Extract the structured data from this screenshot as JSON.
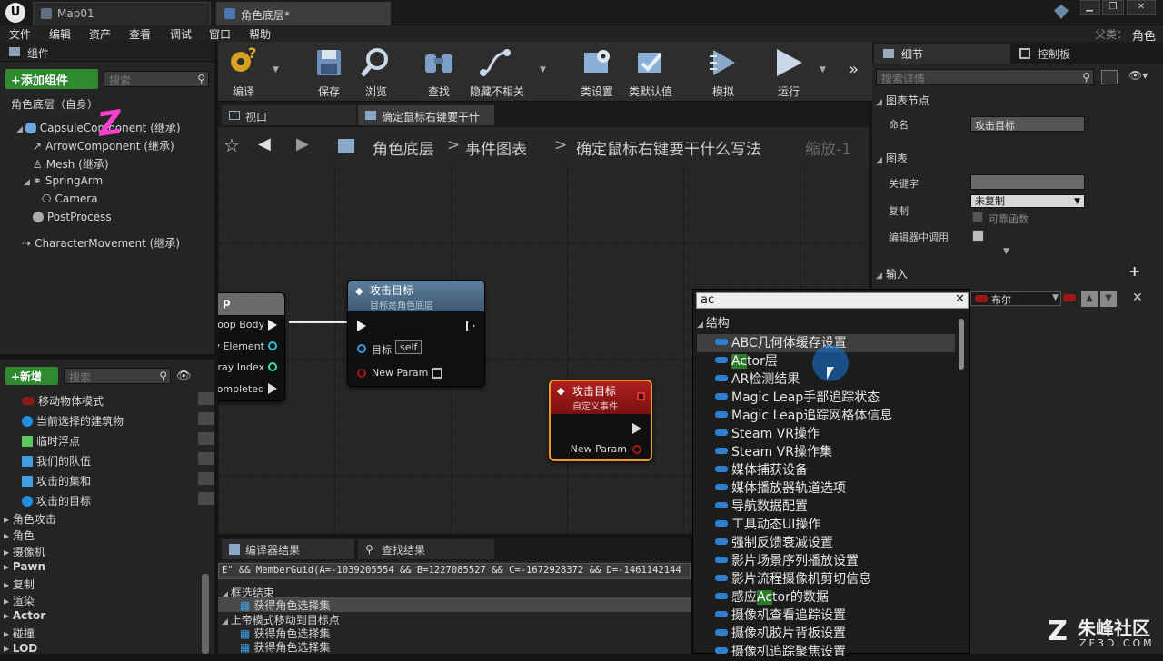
{
  "window": {
    "tabs": [
      {
        "label": "Map01"
      },
      {
        "label": "角色底层*"
      }
    ],
    "parent_label": "父类：",
    "parent_value": "角色"
  },
  "menu": [
    "文件",
    "编辑",
    "资产",
    "查看",
    "调试",
    "窗口",
    "帮助"
  ],
  "components": {
    "title": "组件",
    "add_label": "+添加组件",
    "search_placeholder": "搜索",
    "root": "角色底层（自身）",
    "tree": [
      {
        "label": "CapsuleComponent (继承)",
        "level": 1
      },
      {
        "label": "ArrowComponent (继承)",
        "level": 2
      },
      {
        "label": "Mesh (继承)",
        "level": 2
      },
      {
        "label": "SpringArm",
        "level": 1
      },
      {
        "label": "Camera",
        "level": 2
      },
      {
        "label": "PostProcess",
        "level": 1
      },
      {
        "label": "CharacterMovement (继承)",
        "level": 0
      }
    ],
    "annotation": "Z"
  },
  "my_blueprint": {
    "new_label": "+新增",
    "search_placeholder": "搜索",
    "variables": [
      {
        "label": "移动物体模式",
        "color": "#8b1a1a",
        "type": "pill"
      },
      {
        "label": "当前选择的建筑物",
        "color": "#1f8fe0",
        "type": "dot"
      },
      {
        "label": "临时浮点",
        "color": "#5cc85c",
        "type": "grid"
      },
      {
        "label": "我们的队伍",
        "color": "#3f9fe0",
        "type": "grid"
      },
      {
        "label": "攻击的集和",
        "color": "#3f9fe0",
        "type": "grid"
      },
      {
        "label": "攻击的目标",
        "color": "#1f8fe0",
        "type": "dot"
      }
    ],
    "categories": [
      "角色攻击",
      "角色",
      "摄像机",
      "Pawn",
      "复制",
      "渲染",
      "Actor",
      "碰撞",
      "LOD"
    ]
  },
  "toolbar": {
    "items": [
      "编译",
      "保存",
      "浏览",
      "查找",
      "隐藏不相关",
      "类设置",
      "类默认值",
      "模拟",
      "运行"
    ]
  },
  "graph_tabs": [
    {
      "label": "视口"
    },
    {
      "label": "确定鼠标右键要干什"
    }
  ],
  "breadcrumb": {
    "items": [
      "角色底层",
      "事件图表",
      "确定鼠标右键要干什么写法"
    ],
    "zoom": "缩放-1"
  },
  "nodes": {
    "loop": {
      "title": "p",
      "pins": [
        "Loop Body",
        "y Element",
        "rray Index",
        "Completed"
      ]
    },
    "call": {
      "title": "攻击目标",
      "subtitle": "目标是角色底层",
      "target_label": "目标",
      "self_value": "self",
      "param_label": "New Param"
    },
    "event": {
      "title": "攻击目标",
      "subtitle": "自定义事件",
      "param_label": "New Param"
    }
  },
  "bottom": {
    "tabs": [
      "编译器结果",
      "查找结果"
    ],
    "log_text": "E\" && MemberGuid(A=-1039205554 && B=1227085527 && C=-1672928372 && D=-1461142144",
    "results": [
      {
        "label": "框选结束",
        "level": 0
      },
      {
        "label": "获得角色选择集",
        "level": 1
      },
      {
        "label": "上帝模式移动到目标点",
        "level": 0
      },
      {
        "label": "获得角色选择集",
        "level": 1
      },
      {
        "label": "获得角色选择集",
        "level": 1
      }
    ]
  },
  "dropdown": {
    "query": "ac",
    "group": "结构",
    "items": [
      {
        "pre": "ABC几何体缓存设置",
        "hl": "",
        "post": ""
      },
      {
        "pre": "",
        "hl": "Ac",
        "post": "tor层"
      },
      {
        "pre": "AR检测结果",
        "hl": "",
        "post": ""
      },
      {
        "pre": "Magic Leap手部追踪状态",
        "hl": "",
        "post": ""
      },
      {
        "pre": "Magic Leap追踪网格体信息",
        "hl": "",
        "post": ""
      },
      {
        "pre": "Steam VR操作",
        "hl": "",
        "post": ""
      },
      {
        "pre": "Steam VR操作集",
        "hl": "",
        "post": ""
      },
      {
        "pre": "媒体捕获设备",
        "hl": "",
        "post": ""
      },
      {
        "pre": "媒体播放器轨道选项",
        "hl": "",
        "post": ""
      },
      {
        "pre": "导航数据配置",
        "hl": "",
        "post": ""
      },
      {
        "pre": "工具动态UI操作",
        "hl": "",
        "post": ""
      },
      {
        "pre": "强制反馈衰减设置",
        "hl": "",
        "post": ""
      },
      {
        "pre": "影片场景序列播放设置",
        "hl": "",
        "post": ""
      },
      {
        "pre": "影片流程摄像机剪切信息",
        "hl": "",
        "post": ""
      },
      {
        "pre": "感应",
        "hl": "Ac",
        "post": "tor的数据"
      },
      {
        "pre": "摄像机查看追踪设置",
        "hl": "",
        "post": ""
      },
      {
        "pre": "摄像机胶片背板设置",
        "hl": "",
        "post": ""
      },
      {
        "pre": "摄像机追踪聚焦设置",
        "hl": "",
        "post": ""
      }
    ]
  },
  "details": {
    "tabs": [
      "细节",
      "控制板"
    ],
    "search_placeholder": "搜索详情",
    "graph_node_section": "图表节点",
    "name_label": "命名",
    "name_value": "攻击目标",
    "graph_section": "图表",
    "keyword_label": "关键字",
    "replicate_label": "复制",
    "replicate_value": "未复制",
    "reliable_label": "可靠函数",
    "call_in_editor_label": "编辑器中调用",
    "inputs_section": "输入",
    "input_type": "布尔"
  },
  "watermark": {
    "brand": "朱峰社区",
    "url": "ZF3D.COM"
  }
}
